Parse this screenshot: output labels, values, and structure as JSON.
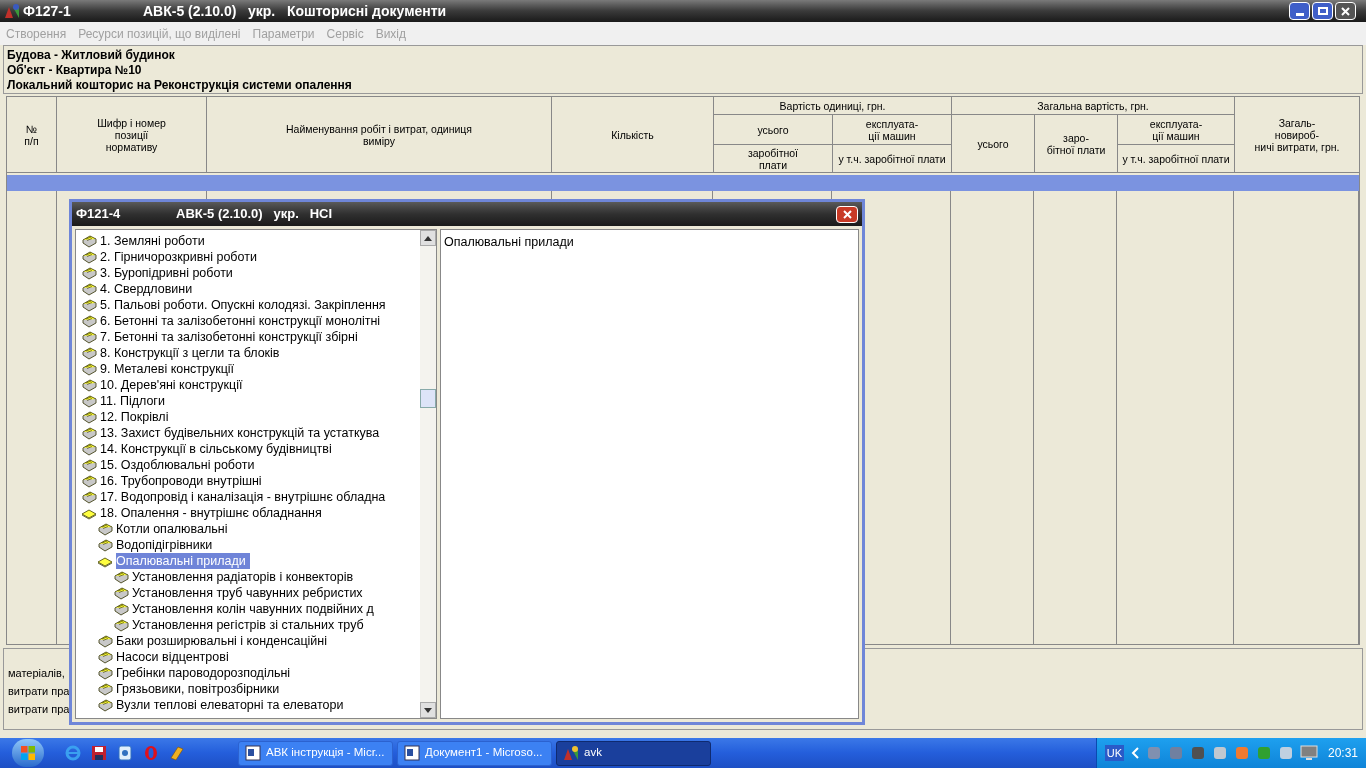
{
  "window": {
    "title_code": "Ф127-1",
    "title": "АВК-5 (2.10.0)   укр.   Кошторисні документи"
  },
  "menu": [
    {
      "label": "Створення",
      "disabled": true
    },
    {
      "label": "Ресурси позицій, що виділені",
      "disabled": true
    },
    {
      "label": "Параметри",
      "disabled": true
    },
    {
      "label": "Сервіс",
      "disabled": true
    },
    {
      "label": "Вихід",
      "disabled": true
    }
  ],
  "header_info": [
    "Будова - Житловий будинок",
    "Об'єкт - Квартира №10",
    "Локальний кошторис на Реконструкція системи опалення"
  ],
  "table": {
    "header_cells": [
      {
        "label": "№\nп/п"
      },
      {
        "label": "Шифр і номер\nпозиції\nнормативу"
      },
      {
        "label": "Найменування робіт і витрат, одиниця\nвиміру"
      },
      {
        "label": "Кількість"
      },
      {
        "label": "Вартість одиниці, грн."
      },
      {
        "label": "усього"
      },
      {
        "label": "заробітної\nплати"
      },
      {
        "label": "експлуата-\nції машин"
      },
      {
        "label": "у т.ч. заробітної плати"
      },
      {
        "label": "Загальна вартість, грн."
      },
      {
        "label": "усього"
      },
      {
        "label": "заро-\nбітної плати"
      },
      {
        "label": "експлуата-\nції машин"
      },
      {
        "label": "у т.ч. заробітної плати"
      },
      {
        "label": "Загаль-\nновироб-\nничі витрати, грн."
      }
    ],
    "rows": [
      {
        "selected": true
      }
    ]
  },
  "bottom_panel": [
    "матеріалів,",
    "витрати пра",
    "витрати пра"
  ],
  "dialog": {
    "title_code": "Ф121-4",
    "title": "АВК-5 (2.10.0)   укр.   НСІ",
    "detail": "Опалювальні прилади",
    "tree": [
      {
        "label": "1. Земляні роботи",
        "expanded": false,
        "selected": false
      },
      {
        "label": "2. Гірничорозкривні роботи",
        "expanded": false,
        "selected": false
      },
      {
        "label": "3. Буропідривні роботи",
        "expanded": false,
        "selected": false
      },
      {
        "label": "4. Свердловини",
        "expanded": false,
        "selected": false
      },
      {
        "label": "5. Пальові роботи. Опускні колодязі. Закріплення",
        "expanded": false,
        "selected": false
      },
      {
        "label": "6. Бетонні та залізобетонні конструкції монолітні",
        "expanded": false,
        "selected": false
      },
      {
        "label": "7. Бетонні та залізобетонні конструкції збірні",
        "expanded": false,
        "selected": false
      },
      {
        "label": "8. Конструкції з цегли та блоків",
        "expanded": false,
        "selected": false
      },
      {
        "label": "9. Металеві конструкції",
        "expanded": false,
        "selected": false
      },
      {
        "label": "10. Дерев'яні конструкції",
        "expanded": false,
        "selected": false
      },
      {
        "label": "11. Підлоги",
        "expanded": false,
        "selected": false
      },
      {
        "label": "12. Покрівлі",
        "expanded": false,
        "selected": false
      },
      {
        "label": "13. Захист будівельних конструкцій та устаткува",
        "expanded": false,
        "selected": false
      },
      {
        "label": "14. Конструкції в сільському будівництві",
        "expanded": false,
        "selected": false
      },
      {
        "label": "15. Оздоблювальні роботи",
        "expanded": false,
        "selected": false
      },
      {
        "label": "16. Трубопроводи внутрішні",
        "expanded": false,
        "selected": false
      },
      {
        "label": "17. Водопровід і каналізація - внутрішнє обладна",
        "expanded": false,
        "selected": false
      },
      {
        "label": "18. Опалення - внутрішнє обладнання",
        "expanded": true,
        "selected": false,
        "children": [
          {
            "label": "Котли опалювальні",
            "expanded": false,
            "selected": false
          },
          {
            "label": "Водопідігрівники",
            "expanded": false,
            "selected": false
          },
          {
            "label": "Опалювальні прилади",
            "expanded": true,
            "selected": true,
            "children": [
              {
                "label": "Установлення радіаторів і конвекторів",
                "expanded": false,
                "selected": false
              },
              {
                "label": "Установлення труб чавунних ребристих",
                "expanded": false,
                "selected": false
              },
              {
                "label": "Установлення колін чавунних подвійних д",
                "expanded": false,
                "selected": false
              },
              {
                "label": "Установлення регістрів зі стальних труб",
                "expanded": false,
                "selected": false
              }
            ]
          },
          {
            "label": "Баки розширювальні і конденсаційні",
            "expanded": false,
            "selected": false
          },
          {
            "label": "Насоси відцентрові",
            "expanded": false,
            "selected": false
          },
          {
            "label": "Гребінки пароводорозподільні",
            "expanded": false,
            "selected": false
          },
          {
            "label": "Грязьовики, повітрозбірники",
            "expanded": false,
            "selected": false
          },
          {
            "label": "Вузли теплові елеваторні та елеватори",
            "expanded": false,
            "selected": false
          }
        ]
      }
    ]
  },
  "taskbar": {
    "tasks": [
      {
        "label": "АВК інструкція - Micr...",
        "kind": "word",
        "selected": false
      },
      {
        "label": "Документ1 - Microso...",
        "kind": "word",
        "selected": false
      },
      {
        "label": "avk",
        "kind": "app",
        "selected": true
      }
    ],
    "language": "UK",
    "time": "20:31"
  }
}
